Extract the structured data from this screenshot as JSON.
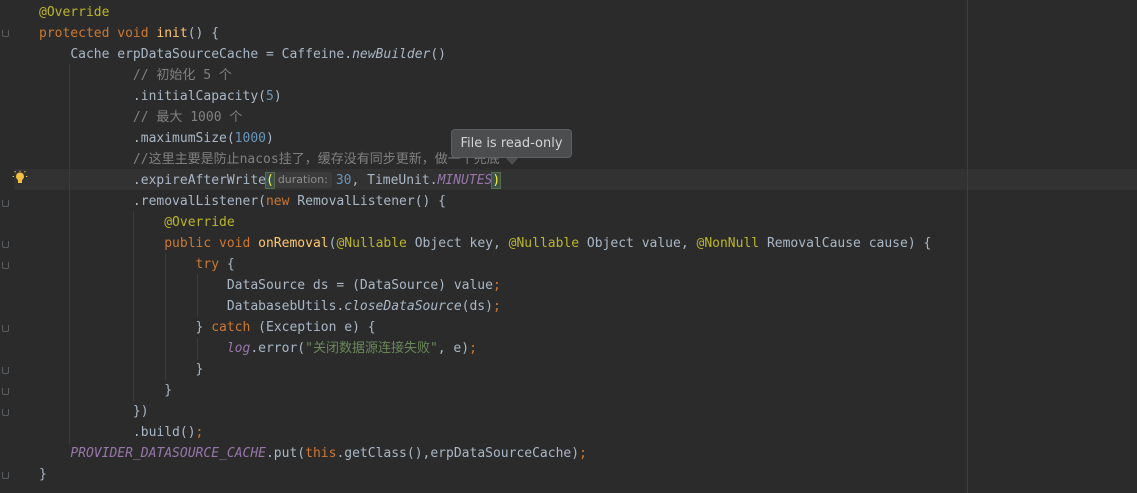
{
  "editor": {
    "lines": {
      "l1": {
        "ann": "@Override"
      },
      "l2": {
        "kw": "protected void ",
        "fn": "init",
        "rest": "() {"
      },
      "l3": {
        "text": "Cache erpDataSourceCache = Caffeine.",
        "it": "newBuilder",
        "rest": "()"
      },
      "l4": {
        "comment": "// 初始化 5 个"
      },
      "l5": {
        "pre": ".initialCapacity(",
        "num": "5",
        "post": ")"
      },
      "l6": {
        "comment": "// 最大 1000 个"
      },
      "l7": {
        "pre": ".maximumSize(",
        "num": "1000",
        "post": ")"
      },
      "l8": {
        "comment": "//这里主要是防止nacos挂了，缓存没有同步更新，做一个兜底"
      },
      "l9": {
        "pre": ".expireAfterWrite",
        "open": "(",
        "hint": "duration:",
        "num": "30",
        "sep": ", TimeUnit.",
        "const": "MINUTES",
        "close": ")"
      },
      "l10": {
        "pre": ".removalListener(",
        "kw": "new ",
        "post": "RemovalListener() {"
      },
      "l11": {
        "ann": "@Override"
      },
      "l12": {
        "kw1": "public void ",
        "fn": "onRemoval",
        "p1": "(",
        "a1": "@Nullable",
        "p2": " Object key, ",
        "a2": "@Nullable",
        "p3": " Object value, ",
        "a3": "@NonNull",
        "p4": " RemovalCause cause) {"
      },
      "l13": {
        "kw": "try",
        "rest": " {"
      },
      "l14": {
        "text": "DataSource ds = (DataSource) value",
        "semi": ";"
      },
      "l15": {
        "pre": "DatabasebUtils.",
        "it": "closeDataSource",
        "post": "(ds)",
        "semi": ";"
      },
      "l16": {
        "pre": "} ",
        "kw": "catch",
        "post": " (Exception e) {"
      },
      "l17": {
        "const": "log",
        "pre": ".error(",
        "str": "\"关闭数据源连接失败\"",
        "post": ", e)",
        "semi": ";"
      },
      "l18": {
        "text": "}"
      },
      "l19": {
        "text": "}"
      },
      "l20": {
        "text": "})"
      },
      "l21": {
        "text": ".build()",
        "semi": ";"
      },
      "l22": {
        "const": "PROVIDER_DATASOURCE_CACHE",
        "pre": ".put(",
        "kw": "this",
        "post": ".getClass(),erpDataSourceCache)",
        "semi": ";"
      },
      "l23": {
        "text": "}"
      }
    },
    "tooltip": "File is read-only",
    "colors": {
      "background": "#2b2b2b",
      "keyword": "#cc7832",
      "annotation": "#bbb529",
      "method": "#ffc66d",
      "number": "#6897bb",
      "string": "#6a8759",
      "comment": "#808080",
      "constant": "#9876aa"
    }
  }
}
